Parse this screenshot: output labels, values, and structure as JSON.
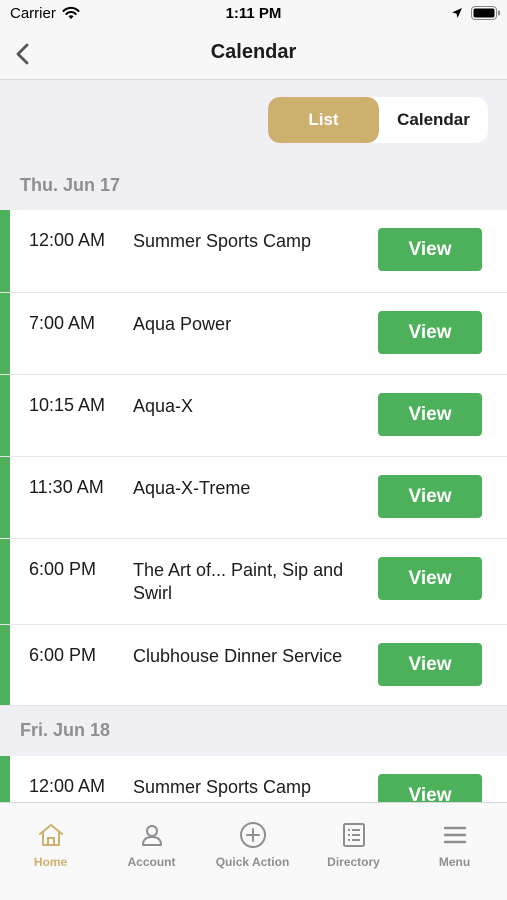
{
  "status_bar": {
    "carrier": "Carrier",
    "time": "1:11 PM"
  },
  "nav": {
    "title": "Calendar",
    "back_icon": "chevron-left-icon"
  },
  "segmented": {
    "list_label": "List",
    "calendar_label": "Calendar",
    "selected": "List"
  },
  "days": [
    {
      "label": "Thu. Jun 17",
      "events": [
        {
          "time": "12:00 AM",
          "name": "Summer Sports Camp",
          "button": "View"
        },
        {
          "time": "7:00 AM",
          "name": "Aqua Power",
          "button": "View"
        },
        {
          "time": "10:15 AM",
          "name": "Aqua-X",
          "button": "View"
        },
        {
          "time": "11:30 AM",
          "name": "Aqua-X-Treme",
          "button": "View"
        },
        {
          "time": "6:00 PM",
          "name": "The Art of... Paint, Sip and Swirl",
          "button": "View"
        },
        {
          "time": "6:00 PM",
          "name": "Clubhouse Dinner Service",
          "button": "View"
        }
      ]
    },
    {
      "label": "Fri. Jun 18",
      "events": [
        {
          "time": "12:00 AM",
          "name": "Summer Sports Camp",
          "button": "View"
        }
      ]
    }
  ],
  "tabs": [
    {
      "label": "Home",
      "icon": "home-icon",
      "active": true
    },
    {
      "label": "Account",
      "icon": "person-icon",
      "active": false
    },
    {
      "label": "Quick Action",
      "icon": "plus-circle-icon",
      "active": false
    },
    {
      "label": "Directory",
      "icon": "list-icon",
      "active": false
    },
    {
      "label": "Menu",
      "icon": "hamburger-menu-icon",
      "active": false
    }
  ],
  "colors": {
    "accent_gold": "#cdb06e",
    "event_green": "#4db05a",
    "background": "#efeff4"
  }
}
